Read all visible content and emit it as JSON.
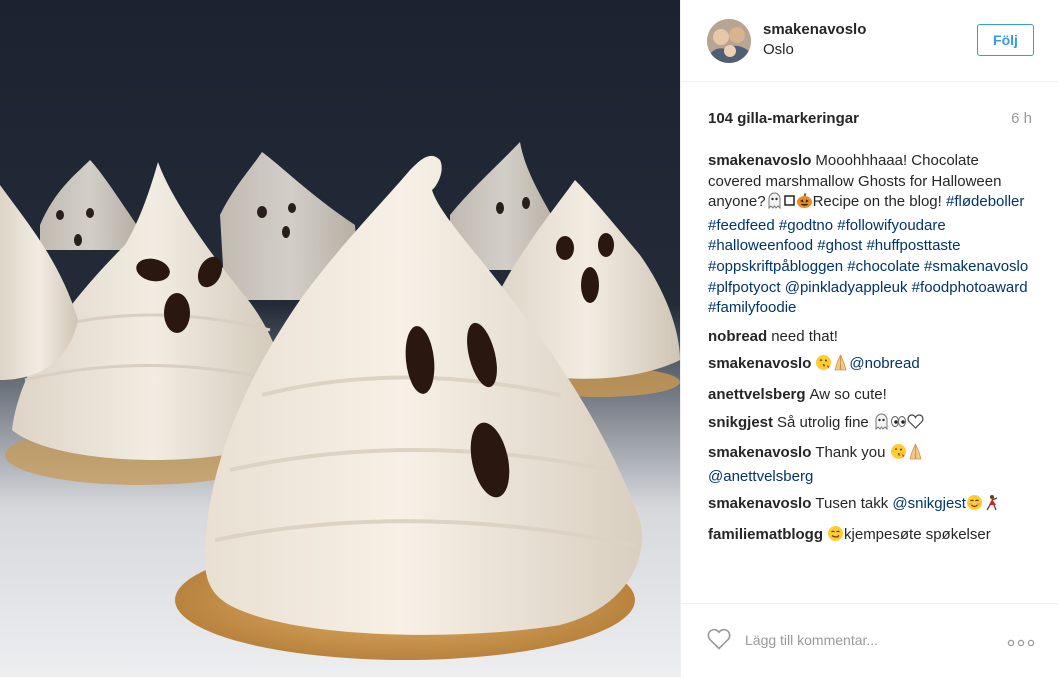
{
  "post": {
    "photo_icon": "food-photo-marshmallow-ghosts"
  },
  "header": {
    "username": "smakenavoslo",
    "location": "Oslo",
    "follow_label": "Följ",
    "avatar_icon": "profile-photo"
  },
  "stats": {
    "likes": "104 gilla-markeringar",
    "time": "6 h"
  },
  "caption": {
    "author": "smakenavoslo",
    "text_1": "Mooohhhaaa! Chocolate covered marshmallow Ghosts for Halloween anyone?",
    "text_2": "Recipe on the blog! ",
    "hashtags": "#flødeboller #feedfeed #godtno #followifyoudare #halloweenfood #ghost #huffposttaste #oppskriftpåbloggen #chocolate #smakenavoslo #plfpotyoct @pinkladyappleuk #foodphotoaward #familyfoodie"
  },
  "comments": [
    {
      "author": "nobread",
      "text": "need that!"
    },
    {
      "author": "smakenavoslo",
      "text": "",
      "mention": "@nobread"
    },
    {
      "author": "anettvelsberg",
      "text": "Aw so cute!"
    },
    {
      "author": "snikgjest",
      "text": "Så utrolig fine "
    },
    {
      "author": "smakenavoslo",
      "text": "Thank you ",
      "mention": "@anettvelsberg"
    },
    {
      "author": "smakenavoslo",
      "text": "Tusen takk ",
      "mention": "@snikgjest"
    },
    {
      "author": "familiematblogg",
      "text": "kjempesøte spøkelser"
    }
  ],
  "footer": {
    "placeholder": "Lägg till kommentar...",
    "like_icon": "heart-icon",
    "more_icon": "more-options-icon"
  },
  "colors": {
    "accent": "#3897f0",
    "link": "#003569",
    "muted": "#999999",
    "text": "#262626"
  }
}
